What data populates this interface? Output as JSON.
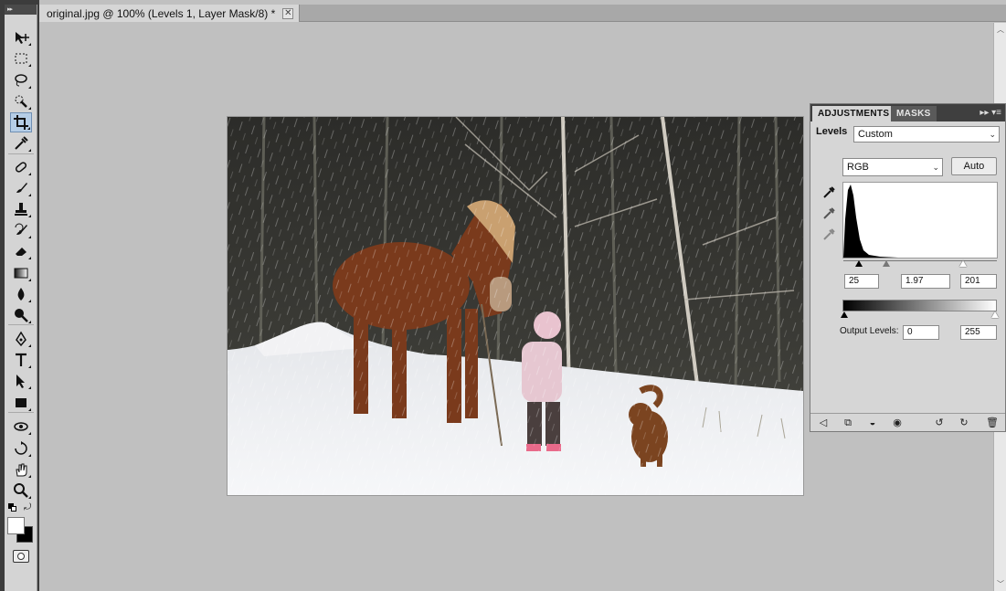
{
  "document": {
    "tab_title": "original.jpg @ 100% (Levels 1, Layer Mask/8) *",
    "close_glyph": "✕"
  },
  "toolbox": {
    "header": "▸▸",
    "tools": [
      {
        "name": "move-tool-icon",
        "active": false
      },
      {
        "name": "rectangular-marquee-tool-icon",
        "active": false
      },
      {
        "name": "lasso-tool-icon",
        "active": false
      },
      {
        "name": "quick-selection-tool-icon",
        "active": false
      },
      {
        "name": "crop-tool-icon",
        "active": true
      },
      {
        "name": "eyedropper-tool-icon",
        "active": false
      },
      {
        "name": "spot-healing-brush-icon",
        "active": false
      },
      {
        "name": "brush-tool-icon",
        "active": false
      },
      {
        "name": "clone-stamp-icon",
        "active": false
      },
      {
        "name": "history-brush-icon",
        "active": false
      },
      {
        "name": "eraser-tool-icon",
        "active": false
      },
      {
        "name": "gradient-tool-icon",
        "active": false
      },
      {
        "name": "blur-tool-icon",
        "active": false
      },
      {
        "name": "dodge-tool-icon",
        "active": false
      },
      {
        "name": "pen-tool-icon",
        "active": false
      },
      {
        "name": "type-tool-icon",
        "active": false
      },
      {
        "name": "path-selection-tool-icon",
        "active": false
      },
      {
        "name": "rectangle-tool-icon",
        "active": false
      },
      {
        "name": "3d-rotate-tool-icon",
        "active": false
      },
      {
        "name": "3d-orbit-tool-icon",
        "active": false
      },
      {
        "name": "hand-tool-icon",
        "active": false
      },
      {
        "name": "zoom-tool-icon",
        "active": false
      }
    ],
    "foreground_color": "#ffffff",
    "background_color": "#000000"
  },
  "adjustments": {
    "tabs": [
      "ADJUSTMENTS",
      "MASKS"
    ],
    "menu_glyph": "▸▸ ▾≡",
    "levels_label": "Levels",
    "preset_value": "Custom",
    "channel_value": "RGB",
    "auto_label": "Auto",
    "input_black": "25",
    "input_gamma": "1.97",
    "input_white": "201",
    "output_label": "Output Levels:",
    "output_black": "0",
    "output_white": "255"
  },
  "colors": {
    "selection_highlight": "#b5cde6",
    "panel_bg": "#d6d6d6",
    "workspace_bg": "#c0c0c0"
  }
}
